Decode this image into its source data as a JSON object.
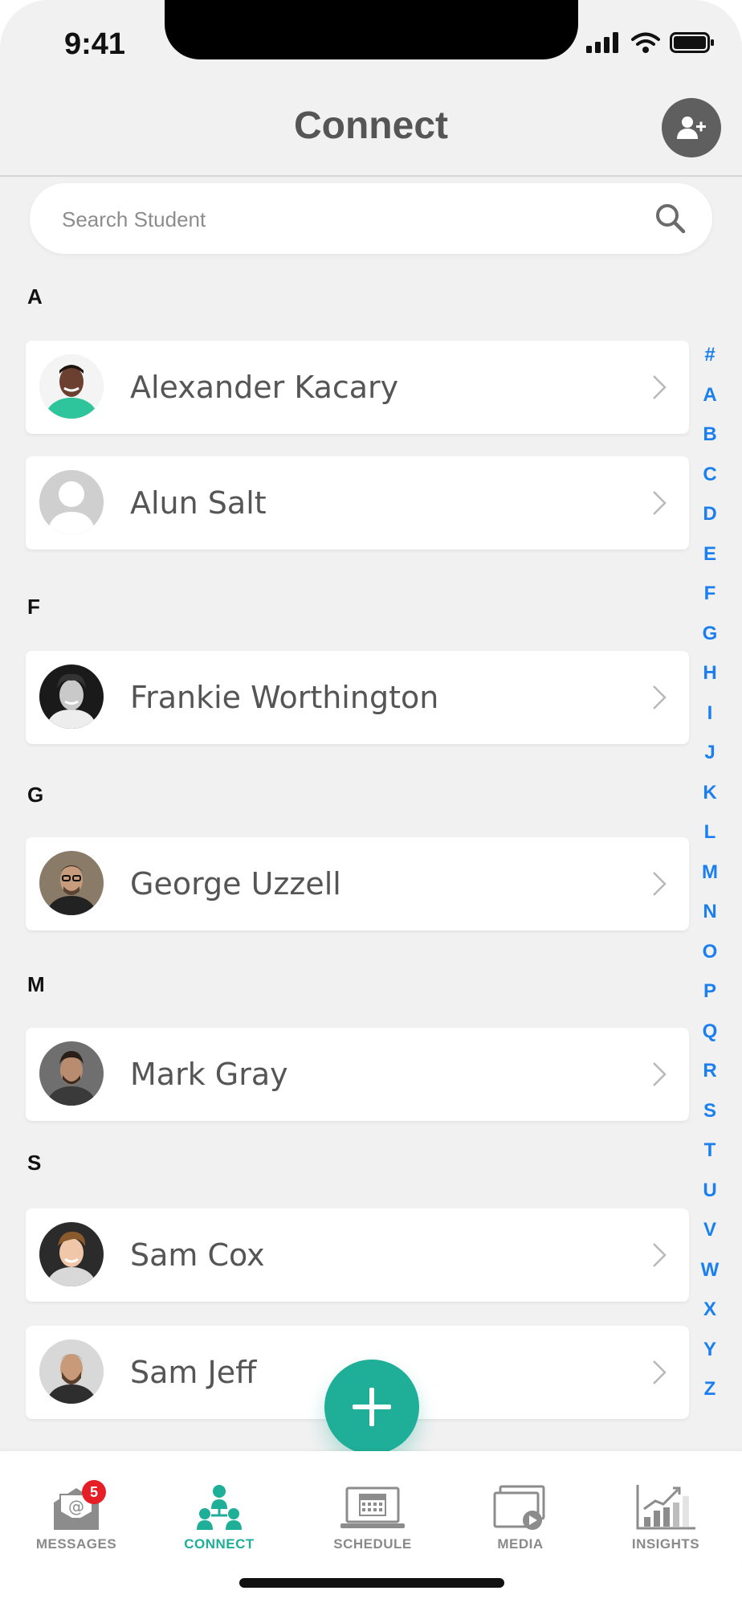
{
  "status_bar": {
    "time": "9:41"
  },
  "header": {
    "title": "Connect",
    "add_user_icon": "add-user-icon"
  },
  "search": {
    "placeholder": "Search Student",
    "icon": "search-icon"
  },
  "sections": [
    {
      "letter": "A",
      "contacts": [
        {
          "name": "Alexander Kacary",
          "avatar": "photo"
        },
        {
          "name": "Alun Salt",
          "avatar": "placeholder"
        }
      ]
    },
    {
      "letter": "F",
      "contacts": [
        {
          "name": "Frankie Worthington",
          "avatar": "photo"
        }
      ]
    },
    {
      "letter": "G",
      "contacts": [
        {
          "name": "George Uzzell",
          "avatar": "photo"
        }
      ]
    },
    {
      "letter": "M",
      "contacts": [
        {
          "name": "Mark Gray",
          "avatar": "photo"
        }
      ]
    },
    {
      "letter": "S",
      "contacts": [
        {
          "name": "Sam Cox",
          "avatar": "photo"
        },
        {
          "name": "Sam Jeff",
          "avatar": "photo"
        }
      ]
    }
  ],
  "alpha_index": [
    "#",
    "A",
    "B",
    "C",
    "D",
    "E",
    "F",
    "G",
    "H",
    "I",
    "J",
    "K",
    "L",
    "M",
    "N",
    "O",
    "P",
    "Q",
    "R",
    "S",
    "T",
    "U",
    "V",
    "W",
    "X",
    "Y",
    "Z"
  ],
  "fab": {
    "icon": "plus-icon"
  },
  "bottom_nav": [
    {
      "label": "MESSAGES",
      "icon": "mail-icon",
      "badge": "5"
    },
    {
      "label": "CONNECT",
      "icon": "network-icon",
      "active": true
    },
    {
      "label": "SCHEDULE",
      "icon": "calendar-icon"
    },
    {
      "label": "MEDIA",
      "icon": "media-icon"
    },
    {
      "label": "INSIGHTS",
      "icon": "chart-icon"
    }
  ],
  "colors": {
    "accent": "#1fae98",
    "index_blue": "#1a7ff0",
    "badge_red": "#e61e25",
    "background": "#f1f1f1"
  }
}
